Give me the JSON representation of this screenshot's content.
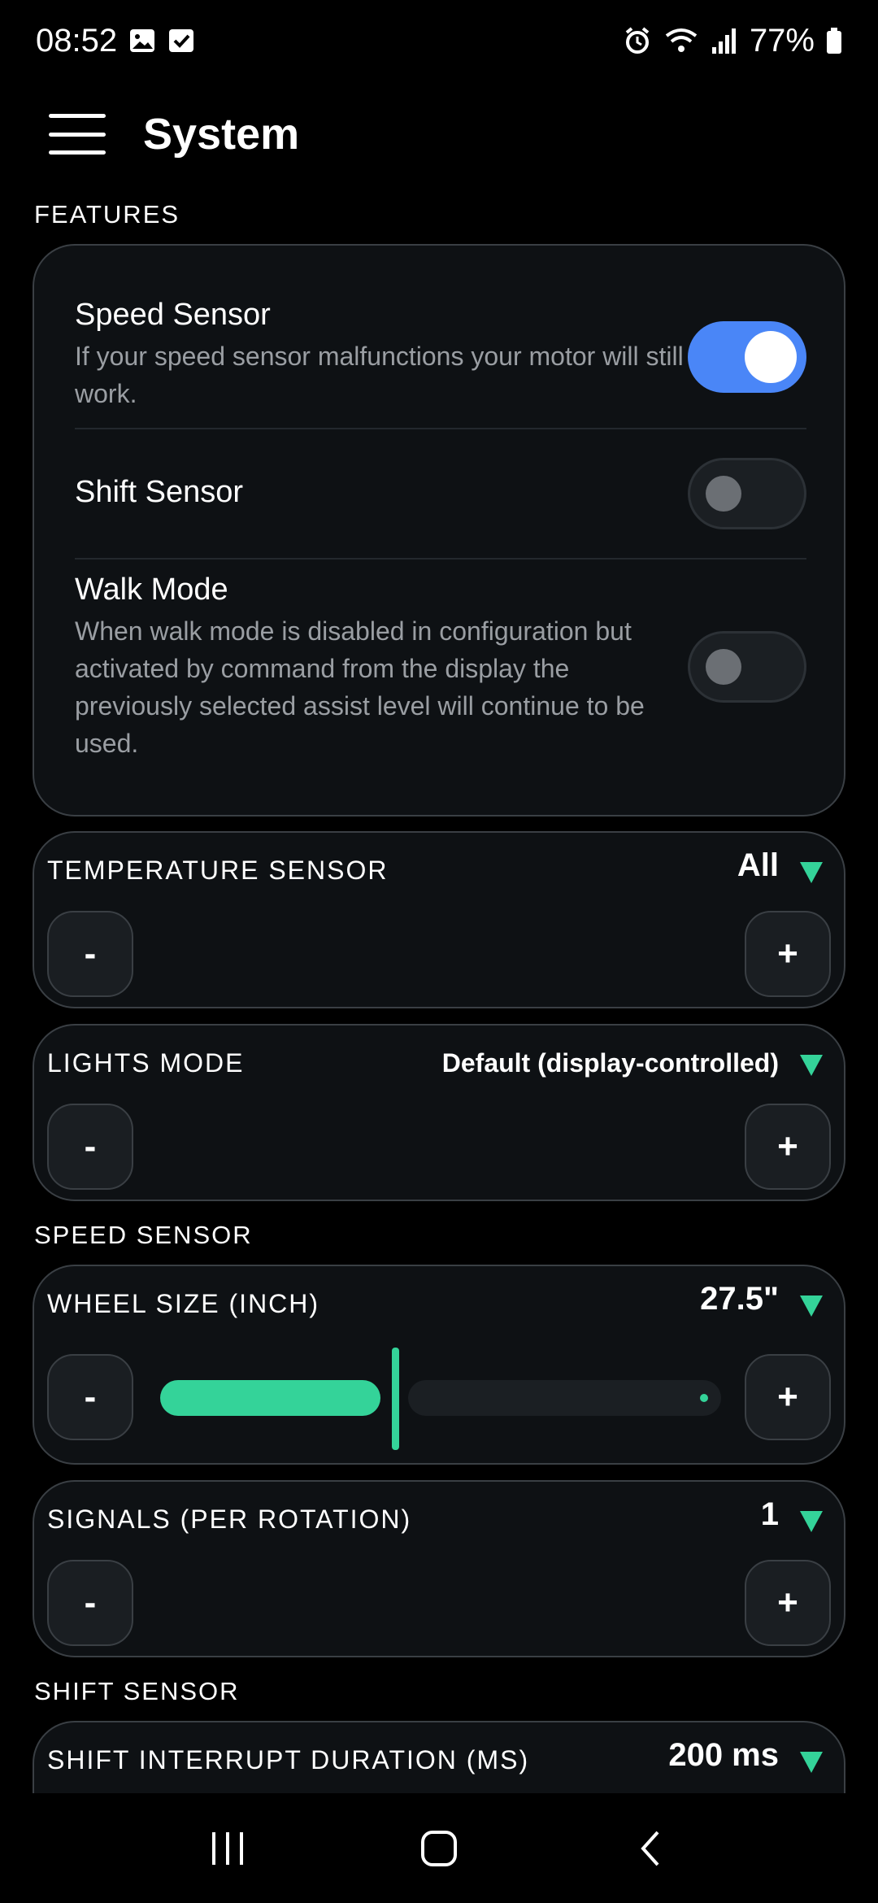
{
  "status_bar": {
    "time": "08:52",
    "battery": "77%",
    "icons": [
      "image-icon",
      "check-box-icon",
      "alarm-icon",
      "wifi-icon",
      "signal-icon",
      "battery-icon"
    ]
  },
  "header": {
    "title": "System",
    "menu_icon": "hamburger-menu-icon"
  },
  "sections": {
    "features": "FEATURES",
    "speed_sensor": "SPEED SENSOR",
    "shift_sensor": "SHIFT SENSOR"
  },
  "features": [
    {
      "title": "Speed Sensor",
      "description": "If your speed sensor malfunctions your motor will still work.",
      "enabled": true
    },
    {
      "title": "Shift Sensor",
      "description": "",
      "enabled": false
    },
    {
      "title": "Walk Mode",
      "description": "When walk mode is disabled in configuration but activated by command from the display the previously selected assist level will continue to be used.",
      "enabled": false
    }
  ],
  "selectors": {
    "temperature_sensor": {
      "label": "TEMPERATURE SENSOR",
      "value": "All"
    },
    "lights_mode": {
      "label": "LIGHTS MODE",
      "value": "Default (display-controlled)"
    },
    "wheel_size": {
      "label": "WHEEL SIZE (INCH)",
      "value": "27.5\"",
      "slider_fraction": 0.41
    },
    "signals": {
      "label": "SIGNALS (PER ROTATION)",
      "value": "1"
    },
    "shift_interrupt": {
      "label": "SHIFT INTERRUPT DURATION (MS)",
      "value": "200 ms"
    }
  },
  "stepper": {
    "minus": "-",
    "plus": "+"
  },
  "colors": {
    "accent_green": "#34d399",
    "toggle_on": "#4a86f7",
    "card_bg": "#0e1114",
    "card_border": "#3a3f44"
  },
  "nav_bar": {
    "icons": [
      "recent-apps-icon",
      "home-icon",
      "back-icon"
    ]
  }
}
